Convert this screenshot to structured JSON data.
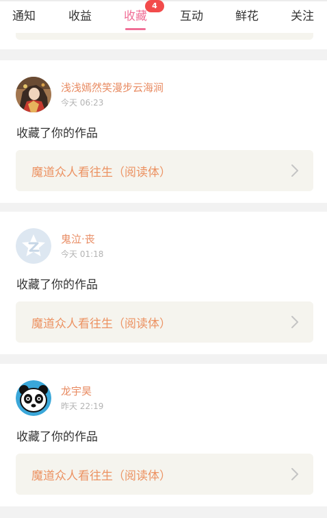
{
  "tabs": [
    {
      "label": "通知"
    },
    {
      "label": "收益"
    },
    {
      "label": "收藏"
    },
    {
      "label": "互动"
    },
    {
      "label": "鲜花"
    },
    {
      "label": "关注"
    }
  ],
  "active_tab_index": 2,
  "favorites_badge": "4",
  "colors": {
    "accent_pink": "#f06e96",
    "username_orange": "#e88b62",
    "work_title_orange": "#ec9262",
    "badge_red": "#f24b4b",
    "card_bg": "#f5f4ee"
  },
  "items": [
    {
      "username": "浅浅嫣然笑漫步云海涧",
      "time": "今天 06:23",
      "action": "收藏了你的作品",
      "work_title": "魔道众人看往生（阅读体）",
      "avatar_icon": "portrait-avatar-icon"
    },
    {
      "username": "鬼泣·丧",
      "time": "今天 01:18",
      "action": "收藏了你的作品",
      "work_title": "魔道众人看往生（阅读体）",
      "avatar_icon": "default-star-avatar-icon"
    },
    {
      "username": "龙宇昊",
      "time": "昨天 22:19",
      "action": "收藏了你的作品",
      "work_title": "魔道众人看往生（阅读体）",
      "avatar_icon": "panda-avatar-icon"
    }
  ]
}
